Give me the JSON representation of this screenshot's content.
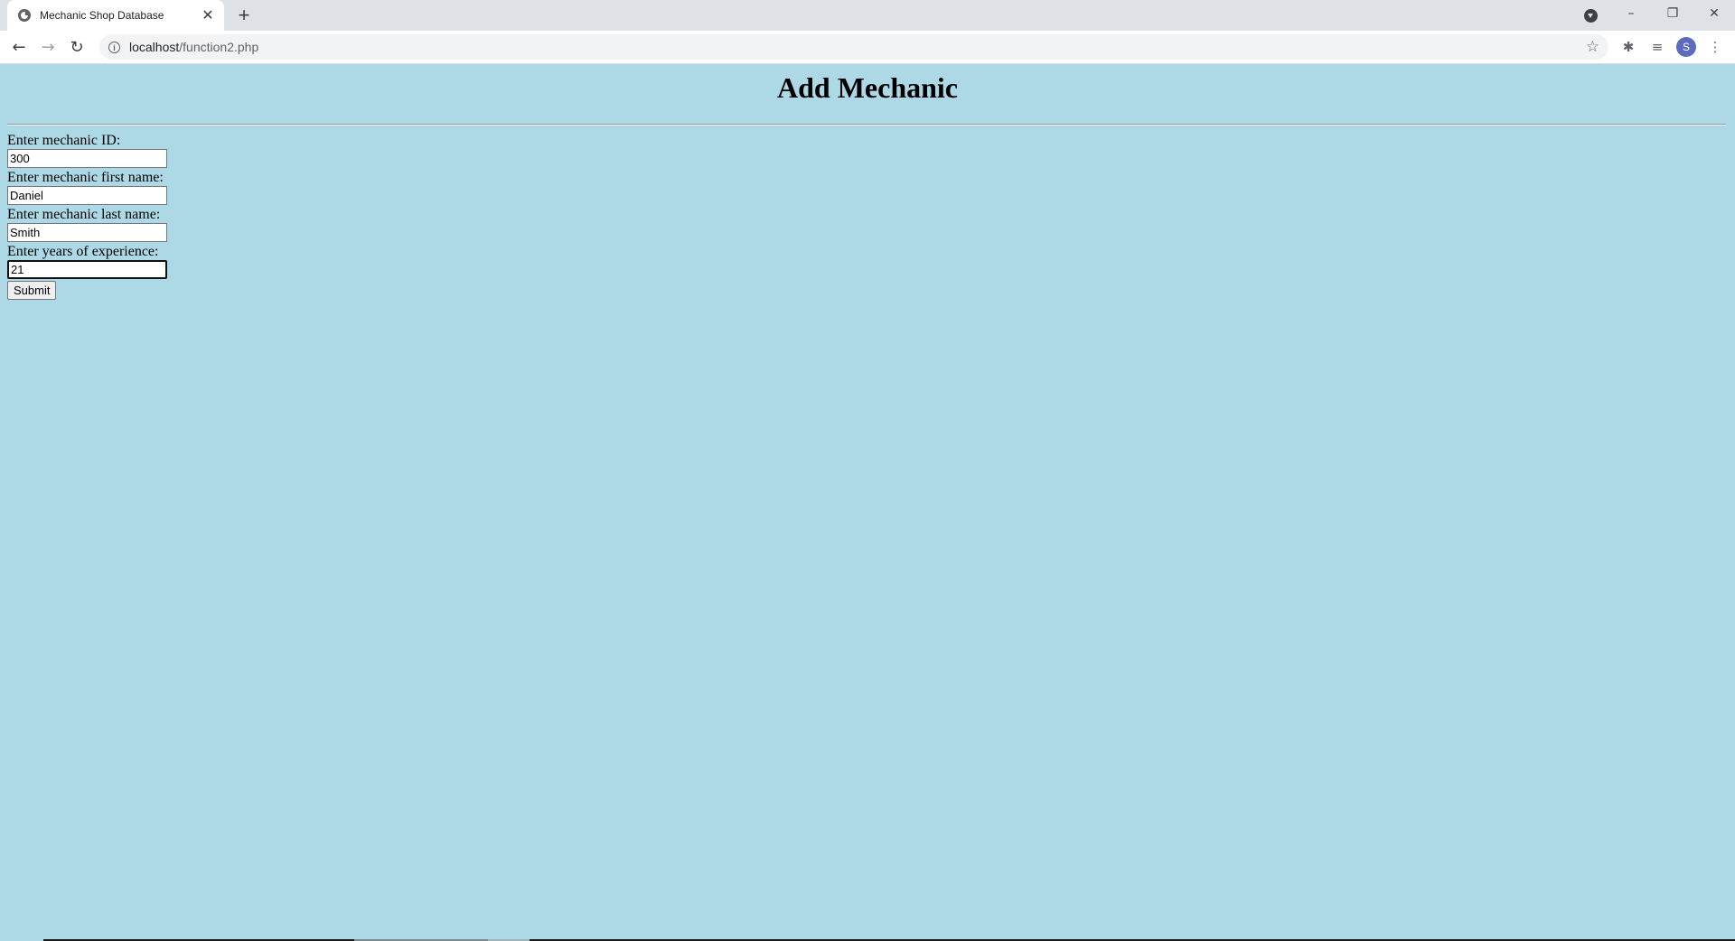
{
  "browser": {
    "tab_title": "Mechanic Shop Database",
    "tab_close": "✕",
    "new_tab": "+",
    "url_host": "localhost",
    "url_path": "/function2.php",
    "avatar_letter": "S",
    "window_minimize": "–",
    "window_restore": "❐",
    "window_close": "✕"
  },
  "page": {
    "heading": "Add Mechanic",
    "background_color": "#add8e6"
  },
  "form": {
    "id_label": "Enter mechanic ID:",
    "id_value": "300",
    "first_name_label": "Enter mechanic first name:",
    "first_name_value": "Daniel",
    "last_name_label": "Enter mechanic last name:",
    "last_name_value": "Smith",
    "experience_label": "Enter years of experience:",
    "experience_value": "21",
    "submit_label": "Submit"
  }
}
